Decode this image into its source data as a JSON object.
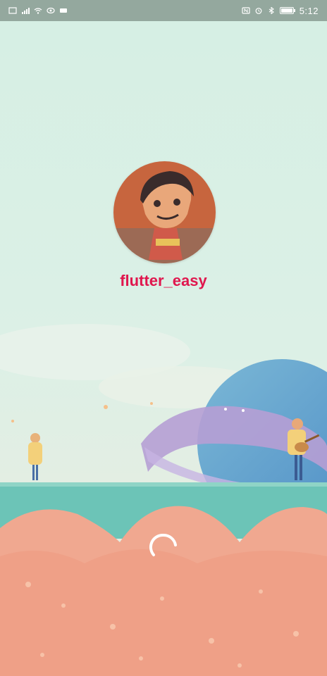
{
  "status_bar": {
    "time": "5:12",
    "left_icons": [
      "sim-icon",
      "signal-icon",
      "wifi-icon",
      "eye-icon",
      "usb-icon"
    ],
    "right_icons": [
      "nfc-icon",
      "alarm-icon",
      "bluetooth-icon",
      "battery-icon"
    ]
  },
  "profile": {
    "username": "flutter_easy",
    "username_color": "#e0174e"
  },
  "loading": {
    "indicator": "spinner"
  },
  "colors": {
    "background": "#d6efe4",
    "ground": "#f0a890",
    "water": "#6cc4b7",
    "planet": "#5a9fce",
    "ring": "#b69fd4"
  }
}
